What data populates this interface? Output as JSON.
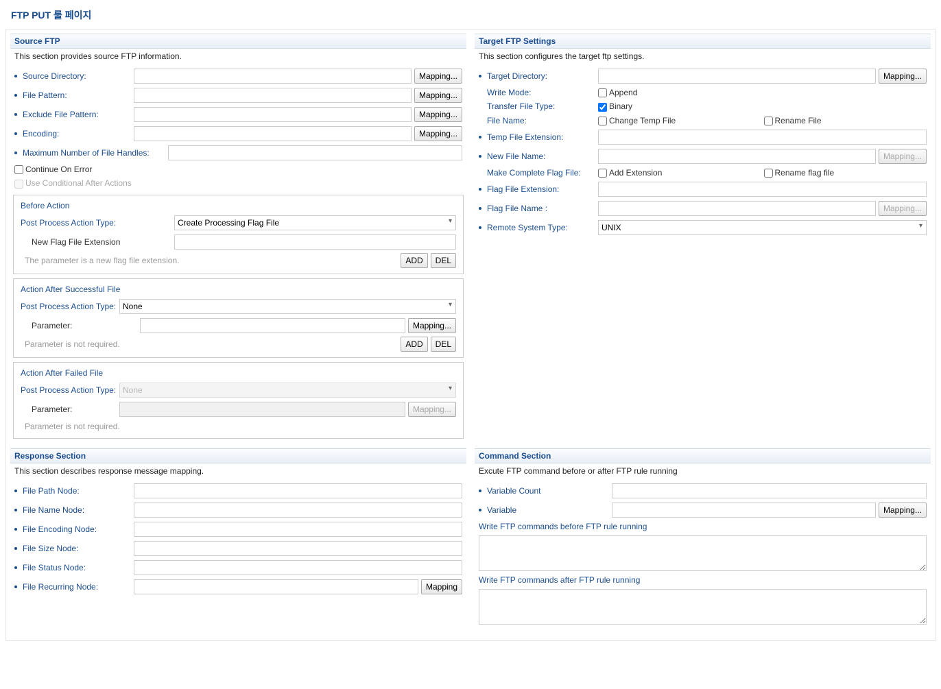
{
  "title": "FTP PUT 룰 페이지",
  "mapping_btn": "Mapping...",
  "mapping_btn_short": "Mapping",
  "add_btn": "ADD",
  "del_btn": "DEL",
  "sourceFtp": {
    "title": "Source FTP",
    "desc": "This section provides source FTP information.",
    "source_dir": "Source Directory:",
    "file_pattern": "File Pattern:",
    "exclude_pattern": "Exclude File Pattern:",
    "encoding": "Encoding:",
    "max_handles": "Maximum Number of File Handles:",
    "continue_on_error": "Continue On Error",
    "use_conditional": "Use Conditional After Actions",
    "before_action": {
      "title": "Before Action",
      "type_label": "Post Process Action Type:",
      "type_value": "Create Processing Flag File",
      "new_flag_ext": "New Flag File Extension",
      "hint": "The parameter is a new flag file extension."
    },
    "after_success": {
      "title": "Action After Successful File",
      "type_label": "Post Process Action Type:",
      "type_value": "None",
      "param_label": "Parameter:",
      "hint": "Parameter is not required."
    },
    "after_failed": {
      "title": "Action After Failed File",
      "type_label": "Post Process Action Type:",
      "type_value": "None",
      "param_label": "Parameter:",
      "hint": "Parameter is not required."
    }
  },
  "targetFtp": {
    "title": "Target FTP Settings",
    "desc": "This section configures the target ftp settings.",
    "target_dir": "Target Directory:",
    "write_mode": "Write Mode:",
    "append": "Append",
    "transfer_type": "Transfer File Type:",
    "binary": "Binary",
    "file_name": "File Name:",
    "change_temp": "Change Temp File",
    "rename_file": "Rename File",
    "temp_ext": "Temp File Extension:",
    "new_file_name": "New File Name:",
    "make_flag": "Make Complete Flag File:",
    "add_ext": "Add Extension",
    "rename_flag": "Rename flag file",
    "flag_ext": "Flag File Extension:",
    "flag_name": "Flag File Name :",
    "remote_type": "Remote System Type:",
    "remote_type_value": "UNIX"
  },
  "response": {
    "title": "Response Section",
    "desc": "This section describes response message mapping.",
    "file_path": "File Path Node:",
    "file_name": "File Name Node:",
    "file_encoding": "File Encoding Node:",
    "file_size": "File Size Node:",
    "file_status": "File Status Node:",
    "file_recurring": "File Recurring Node:"
  },
  "command": {
    "title": "Command Section",
    "desc": "Excute FTP command before or after FTP rule running",
    "var_count": "Variable Count",
    "variable": "Variable",
    "before_cmd": "Write FTP commands before FTP rule running",
    "after_cmd": "Write FTP commands after FTP rule running"
  }
}
